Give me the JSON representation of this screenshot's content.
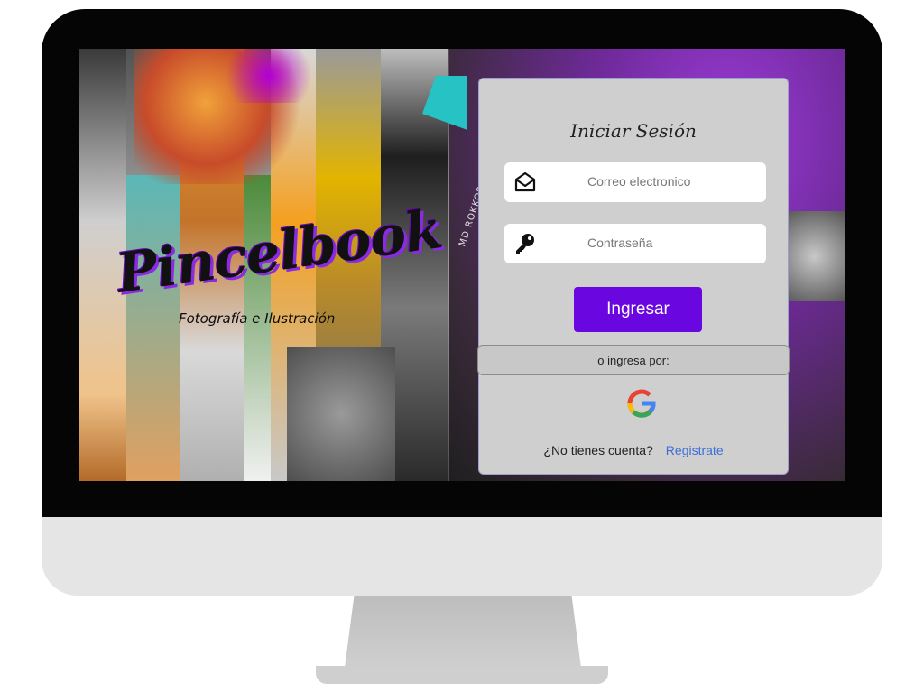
{
  "brand": {
    "logo_text": "Pincelbook",
    "tagline": "Fotografía e Ilustración",
    "lens_text": "MD ROKKOR"
  },
  "login": {
    "title": "Iniciar Sesión",
    "email_placeholder": "Correo electronico",
    "email_icon": "envelope-icon",
    "password_placeholder": "Contraseña",
    "password_icon": "key-icon",
    "submit_label": "Ingresar",
    "alt_label": "o ingresa por:",
    "google_icon": "google-icon",
    "no_account_text": "¿No tienes cuenta?",
    "register_link": "Registrate"
  },
  "colors": {
    "accent": "#6a06e0",
    "link": "#3b6fd6",
    "card_bg": "#cfcfcf"
  }
}
